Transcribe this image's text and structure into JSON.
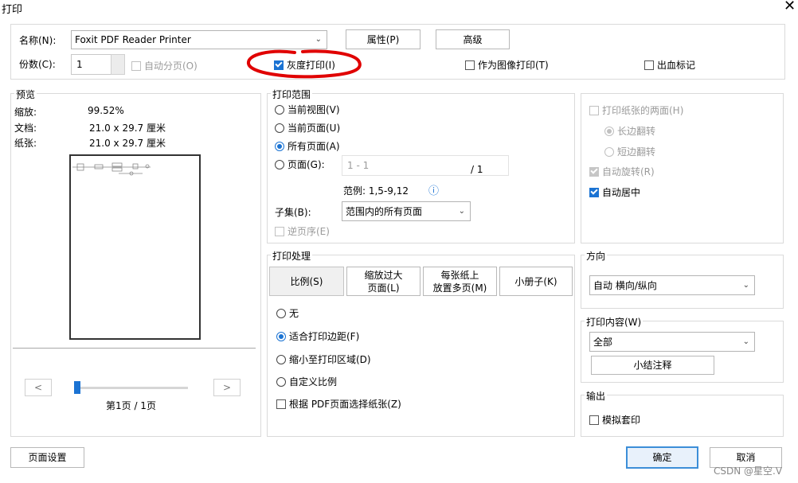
{
  "window": {
    "title": "打印",
    "close_glyph": "✕"
  },
  "printer": {
    "name_label": "名称(N):",
    "name_value": "Foxit PDF Reader Printer",
    "properties_button": "属性(P)",
    "advanced_button": "高级",
    "copies_label": "份数(C):",
    "copies_value": "1",
    "collate_label": "自动分页(O)",
    "grayscale_label": "灰度打印(I)",
    "print_as_image_label": "作为图像打印(T)",
    "bleed_marks_label": "出血标记",
    "annotation_color": "#e00000"
  },
  "preview": {
    "title": "预览",
    "zoom_label": "缩放:",
    "zoom_value": "99.52%",
    "document_label": "文档:",
    "document_value": "21.0 x 29.7 厘米",
    "paper_label": "纸张:",
    "paper_value": "21.0 x 29.7 厘米",
    "prev_button": "<",
    "next_button": ">",
    "page_indicator": "第1页 / 1页",
    "slider_position": 0
  },
  "print_range": {
    "title": "打印范围",
    "current_view": "当前视图(V)",
    "current_page": "当前页面(U)",
    "all_pages": "所有页面(A)",
    "pages": "页面(G):",
    "pages_placeholder": "1 - 1",
    "pages_total": "/ 1",
    "example": "范例: 1,5-9,12",
    "info_icon": "ⓘ",
    "subset_label": "子集(B):",
    "subset_value": "范围内的所有页面",
    "reverse_label": "逆页序(E)"
  },
  "print_handling": {
    "title": "打印处理",
    "tab_scale": "比例(S)",
    "tab_tile_line1": "缩放过大",
    "tab_tile_line2": "页面(L)",
    "tab_multi_line1": "每张纸上",
    "tab_multi_line2": "放置多页(M)",
    "tab_booklet": "小册子(K)",
    "opt_none": "无",
    "opt_fit_margins": "适合打印边距(F)",
    "opt_shrink": "缩小至打印区域(D)",
    "opt_custom": "自定义比例",
    "choose_paper": "根据 PDF页面选择纸张(Z)"
  },
  "duplex": {
    "both_sides": "打印纸张的两面(H)",
    "long_edge": "长边翻转",
    "short_edge": "短边翻转",
    "auto_rotate": "自动旋转(R)",
    "auto_center": "自动居中"
  },
  "orientation": {
    "title": "方向",
    "value": "自动 横向/纵向"
  },
  "content": {
    "title": "打印内容(W)",
    "value": "全部",
    "summary_button": "小结注释"
  },
  "output": {
    "title": "输出",
    "simulate_overprint": "模拟套印"
  },
  "footer": {
    "page_setup": "页面设置",
    "ok": "确定",
    "cancel": "取消",
    "watermark": "CSDN @星空.V"
  }
}
